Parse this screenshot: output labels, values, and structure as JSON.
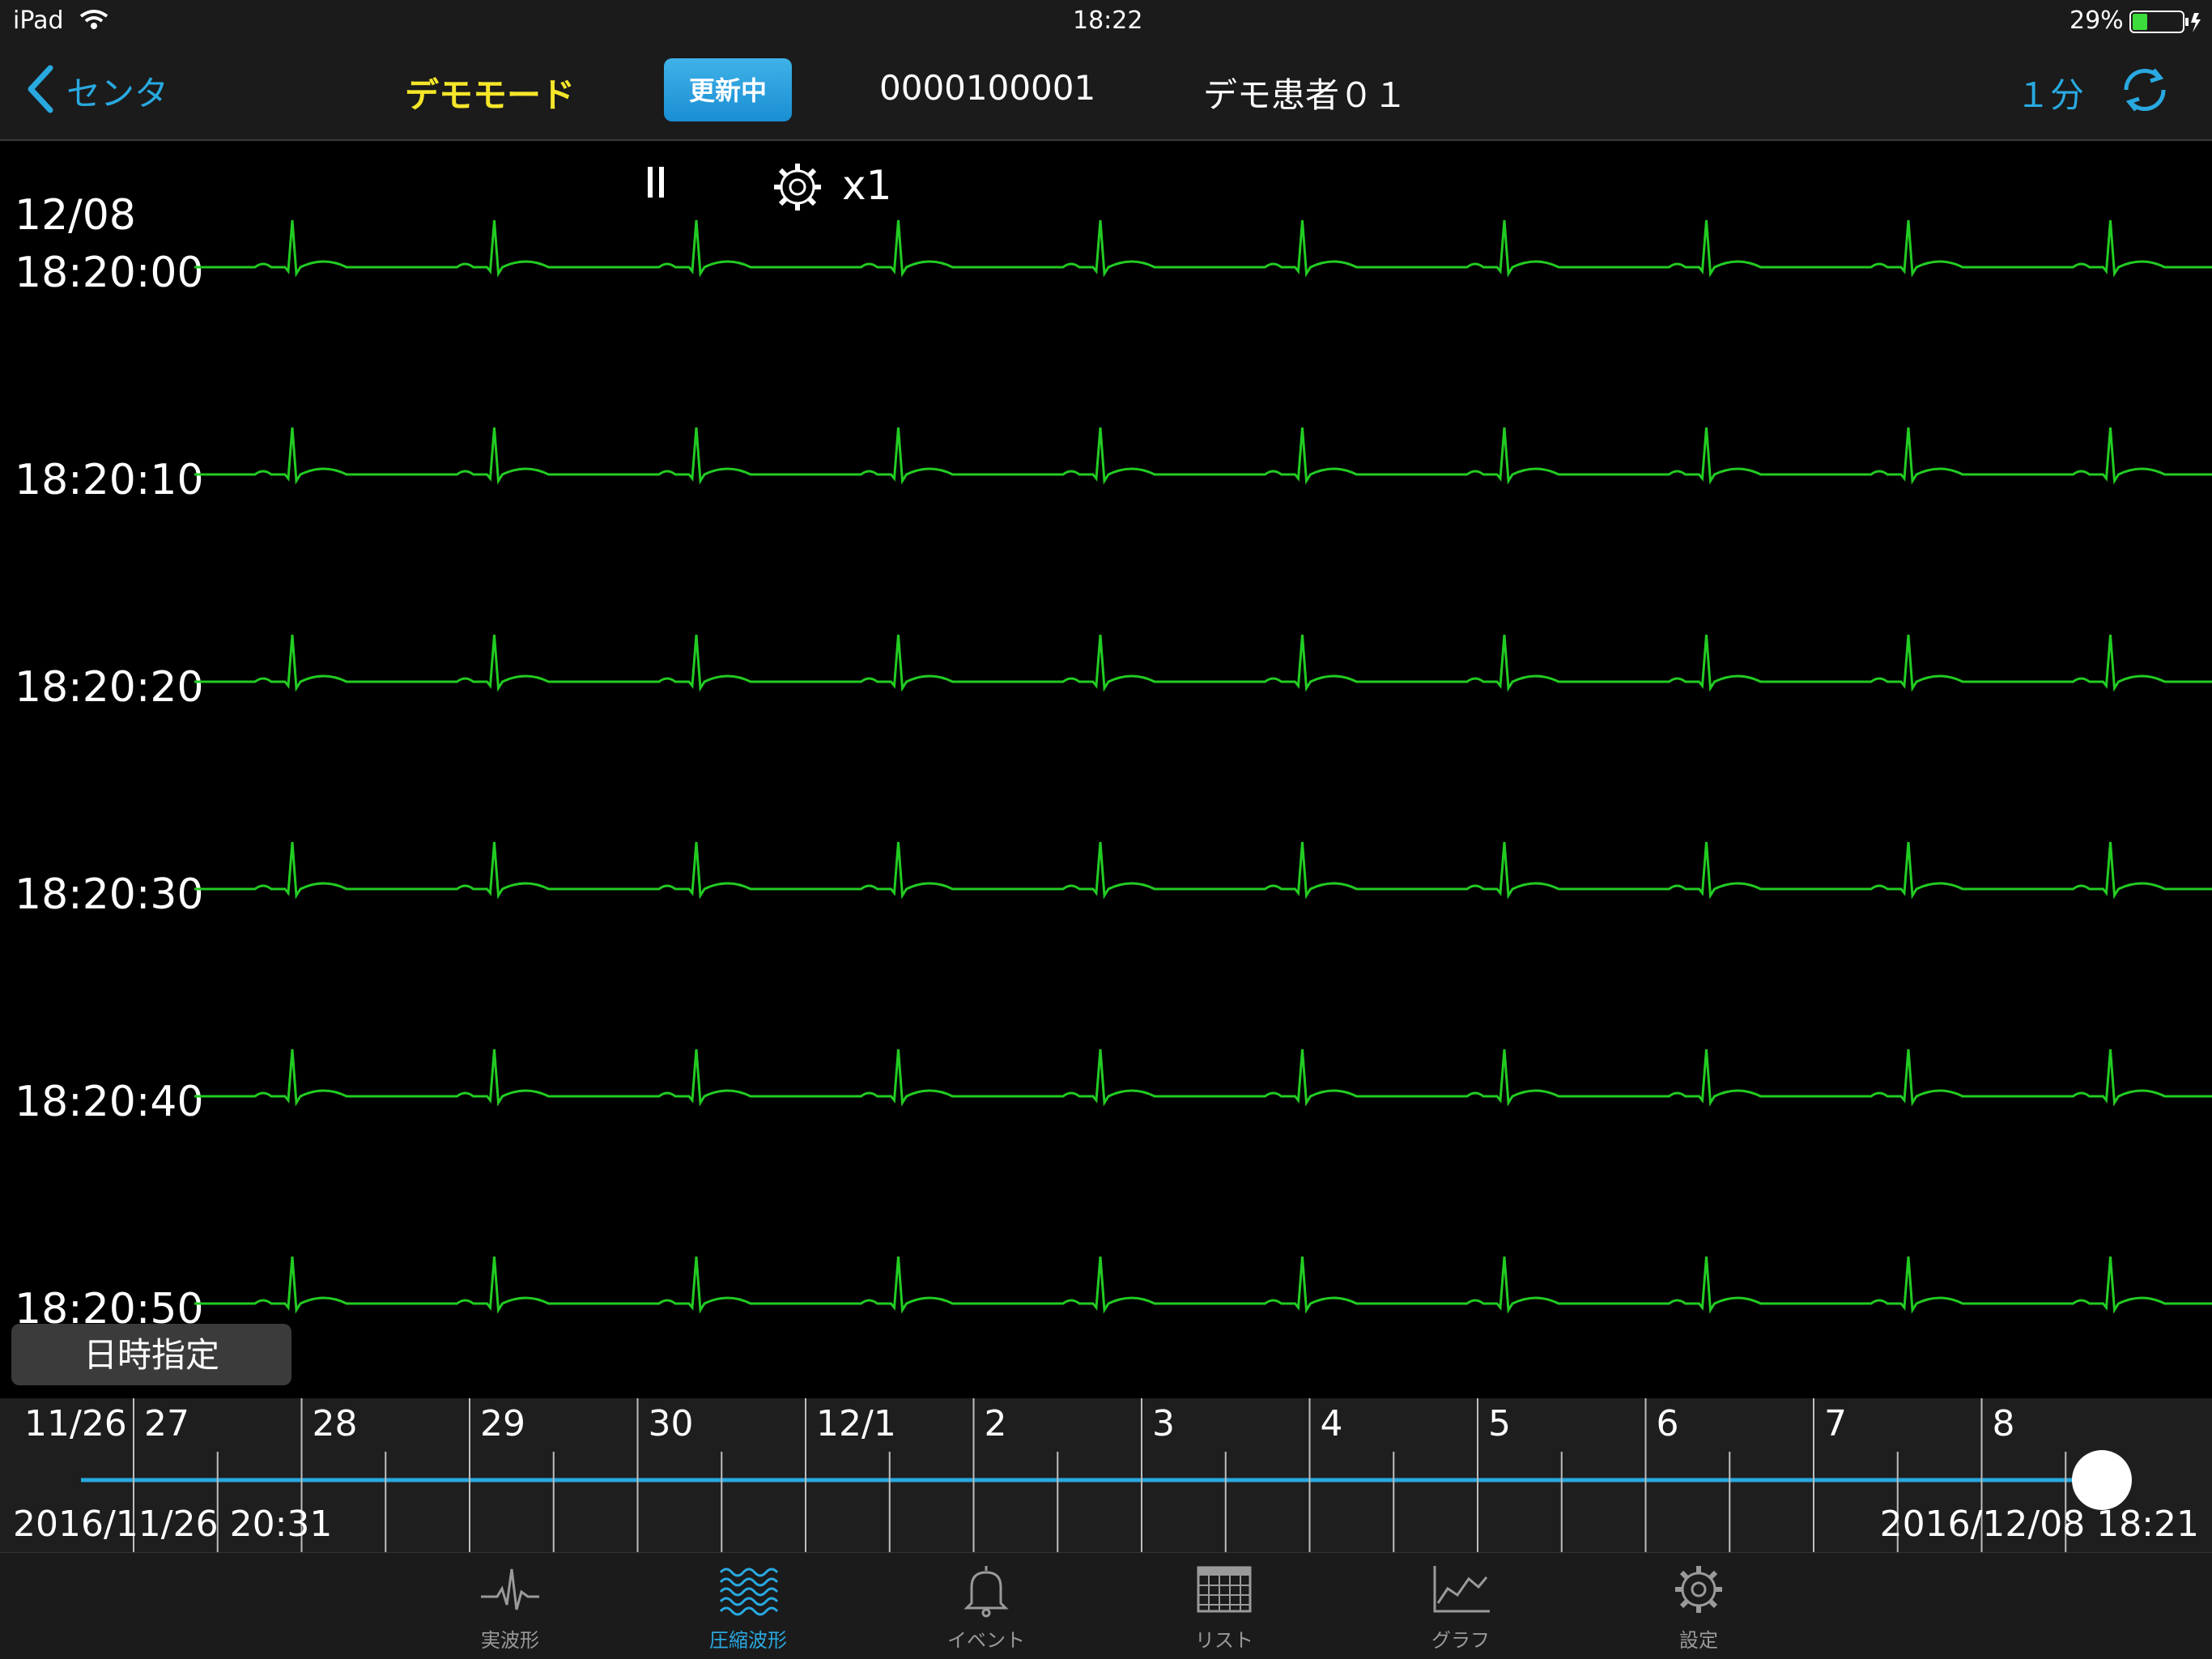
{
  "status_bar": {
    "device": "iPad",
    "time": "18:22",
    "battery": "29%"
  },
  "nav": {
    "back_label": "センタ",
    "mode_label": "デモモード",
    "update_button": "更新中",
    "patient_id": "0000100001",
    "patient_name": "デモ患者０１",
    "interval": "１分"
  },
  "controls": {
    "speed": "x1"
  },
  "waveform": {
    "date": "12/08",
    "rows": [
      "18:20:00",
      "18:20:10",
      "18:20:20",
      "18:20:30",
      "18:20:40",
      "18:20:50"
    ]
  },
  "date_button": "日時指定",
  "timeline": {
    "days": [
      "11/26",
      "27",
      "28",
      "29",
      "30",
      "12/1",
      "2",
      "3",
      "4",
      "5",
      "6",
      "7",
      "8"
    ],
    "start": "2016/11/26 20:31",
    "end": "2016/12/08 18:21",
    "position": 1.0
  },
  "tabs": [
    {
      "label": "実波形",
      "icon": "ecg-icon",
      "active": false
    },
    {
      "label": "圧縮波形",
      "icon": "compressed-wave-icon",
      "active": true
    },
    {
      "label": "イベント",
      "icon": "bell-icon",
      "active": false
    },
    {
      "label": "リスト",
      "icon": "list-icon",
      "active": false
    },
    {
      "label": "グラフ",
      "icon": "graph-icon",
      "active": false
    },
    {
      "label": "設定",
      "icon": "settings-icon",
      "active": false
    }
  ],
  "colors": {
    "accent": "#29a9e0",
    "mode": "#f5e62a",
    "wave": "#22cc22",
    "active_tab": "#29a9e0",
    "inactive_tab": "#9a9a9a"
  }
}
